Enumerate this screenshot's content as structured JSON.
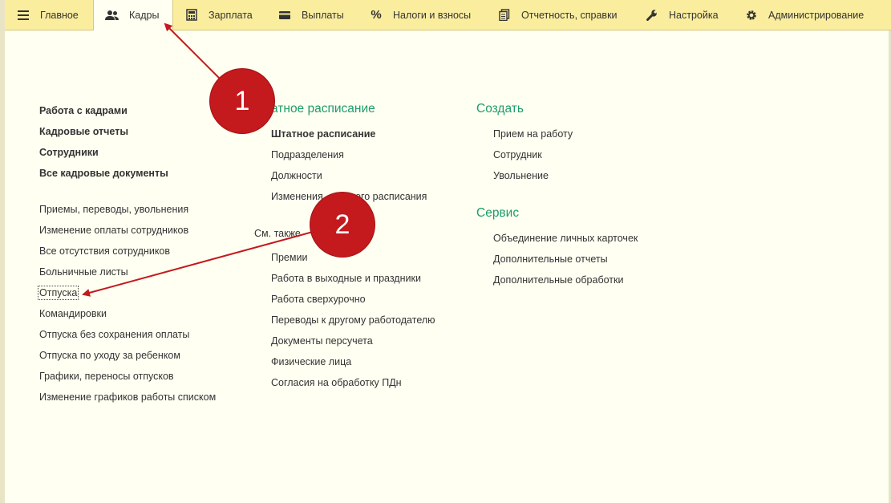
{
  "menu": {
    "tabs": [
      {
        "label": "Главное",
        "icon": "hamburger-icon"
      },
      {
        "label": "Кадры",
        "icon": "users-icon",
        "active": true
      },
      {
        "label": "Зарплата",
        "icon": "calculator-icon"
      },
      {
        "label": "Выплаты",
        "icon": "wallet-icon"
      },
      {
        "label": "Налоги и взносы",
        "icon": "percent-icon"
      },
      {
        "label": "Отчетность, справки",
        "icon": "documents-icon"
      },
      {
        "label": "Настройка",
        "icon": "wrench-icon"
      },
      {
        "label": "Администрирование",
        "icon": "gear-icon"
      }
    ]
  },
  "main_links": {
    "bold": [
      "Работа с кадрами",
      "Кадровые отчеты",
      "Сотрудники",
      "Все кадровые документы"
    ],
    "regular": [
      "Приемы, переводы, увольнения",
      "Изменение оплаты сотрудников",
      "Все отсутствия сотрудников",
      "Больничные листы",
      "Отпуска",
      "Командировки",
      "Отпуска без сохранения оплаты",
      "Отпуска по уходу за ребенком",
      "Графики, переносы отпусков",
      "Изменение графиков работы списком"
    ]
  },
  "staffing": {
    "heading": "атное расписание",
    "bold_item": "Штатное расписание",
    "items": [
      "Подразделения",
      "Должности",
      "Изменения",
      "ого расписания"
    ],
    "see_also": "См. также",
    "see_also_items": [
      "Премии",
      "Работа в выходные и праздники",
      "Работа сверхурочно",
      "Переводы к другому работодателю",
      "Документы персучета",
      "Физические лица",
      "Согласия на обработку ПДн"
    ]
  },
  "create": {
    "heading": "Создать",
    "items": [
      "Прием на работу",
      "Сотрудник",
      "Увольнение"
    ]
  },
  "service": {
    "heading": "Сервис",
    "items": [
      "Объединение личных карточек",
      "Дополнительные отчеты",
      "Дополнительные обработки"
    ]
  },
  "annotations": {
    "callout_1": "1",
    "callout_2": "2",
    "color": "#c4191d"
  },
  "colors": {
    "menu_bg": "#fbed9e",
    "page_bg": "#fffff2",
    "heading": "#1d9c6c"
  }
}
